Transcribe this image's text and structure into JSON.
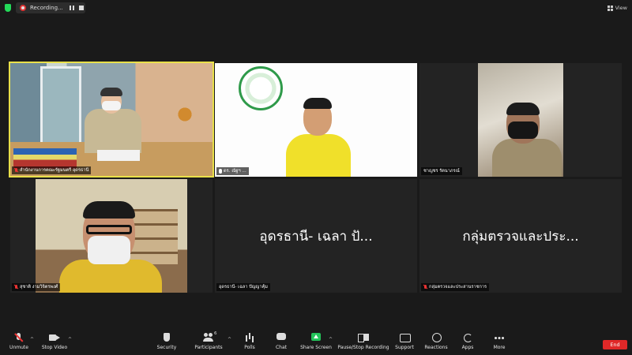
{
  "topbar": {
    "recording_label": "Recording...",
    "view_label": "View"
  },
  "participants": [
    {
      "name": "สำนักงานการคณะรัฐมนตรี อุดรธานี",
      "muted": true
    },
    {
      "name": "ดร. ณัฐฯ ...",
      "muted": false
    },
    {
      "name": "ชาญชร รัตนาภรณ์",
      "muted": false
    },
    {
      "name": "สุชาติ งามวิจิตรพงศ์",
      "muted": true
    },
    {
      "name": "อุดรธานี- เฉลา ปัญญาคุ้ม",
      "display": "อุดรธานี- เฉลา ปั...",
      "muted": false
    },
    {
      "name": "กลุ่มตรวจและประสานราชการ",
      "display": "กลุ่มตรวจและประ...",
      "muted": true
    }
  ],
  "toolbar": {
    "unmute": "Unmute",
    "stop_video": "Stop Video",
    "security": "Security",
    "participants": "Participants",
    "participants_count": "6",
    "polls": "Polls",
    "chat": "Chat",
    "share_screen": "Share Screen",
    "pause_stop_recording": "Pause/Stop Recording",
    "support": "Support",
    "reactions": "Reactions",
    "apps": "Apps",
    "more": "More",
    "end": "End"
  },
  "colors": {
    "active_speaker_border": "#e9e04a",
    "share_green": "#23c35a",
    "end_red": "#e02828",
    "muted_red": "#e33333"
  }
}
